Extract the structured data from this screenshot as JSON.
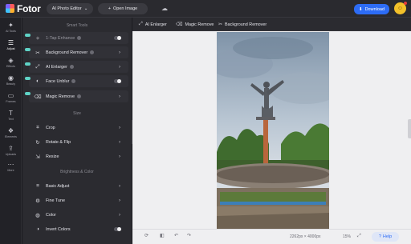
{
  "app": {
    "logo_text": "Fotor",
    "editor_label": "AI Photo Editor",
    "editor_chevron": "⌄",
    "open_image_label": "Open Image",
    "open_image_icon": "+",
    "download_label": "Download",
    "download_icon": "⬇",
    "cloud_icon": "☁",
    "avatar_icon": "☺"
  },
  "rail": [
    {
      "name": "ai-tools",
      "label": "AI Tools",
      "icon": "✦"
    },
    {
      "name": "adjust",
      "label": "Adjust",
      "icon": "☰"
    },
    {
      "name": "effects",
      "label": "Effects",
      "icon": "◈"
    },
    {
      "name": "beauty",
      "label": "Beauty",
      "icon": "◉"
    },
    {
      "name": "frames",
      "label": "Frames",
      "icon": "▭"
    },
    {
      "name": "text",
      "label": "Text",
      "icon": "T"
    },
    {
      "name": "elements",
      "label": "Elements",
      "icon": "❖"
    },
    {
      "name": "uploads",
      "label": "Uploads",
      "icon": "⇪"
    },
    {
      "name": "more",
      "label": "More",
      "icon": "⋯"
    }
  ],
  "panel": {
    "section_smart": "Smart Tools",
    "section_size": "Size",
    "section_brightness": "Brightness & Color",
    "smart_items": [
      {
        "label": "1-Tap Enhance",
        "icon": "✧",
        "control": "toggle",
        "dim": true
      },
      {
        "label": "Background Remover",
        "icon": "✂",
        "control": "chevron",
        "dim": false
      },
      {
        "label": "AI Enlarger",
        "icon": "⤢",
        "control": "chevron",
        "dim": false
      },
      {
        "label": "Face Unblur",
        "icon": "◐",
        "control": "toggle",
        "dim": false
      },
      {
        "label": "Magic Remove",
        "icon": "⌫",
        "control": "chevron",
        "dim": false
      }
    ],
    "size_items": [
      {
        "label": "Crop",
        "icon": "⌗"
      },
      {
        "label": "Rotate & Flip",
        "icon": "↻"
      },
      {
        "label": "Resize",
        "icon": "⇲"
      }
    ],
    "color_items": [
      {
        "label": "Basic Adjust",
        "icon": "≡",
        "control": "chevron"
      },
      {
        "label": "Fine Tune",
        "icon": "⚙",
        "control": "chevron"
      },
      {
        "label": "Color",
        "icon": "◍",
        "control": "chevron"
      },
      {
        "label": "Invert Colors",
        "icon": "◑",
        "control": "toggle"
      }
    ],
    "chevron": "›",
    "collapse_icon": "‹"
  },
  "subtoolbar": {
    "ai_enlarger": "AI Enlarger",
    "magic_remove": "Magic Remove",
    "background_remover": "Background Remover"
  },
  "bottom": {
    "dimensions": "2262px × 4000px",
    "zoom": "15%",
    "help_label": "Help",
    "help_icon": "?"
  },
  "colors": {
    "accent": "#2d6cf5",
    "ai_tag": "#5fd3c6",
    "panel": "#2b2b30"
  }
}
